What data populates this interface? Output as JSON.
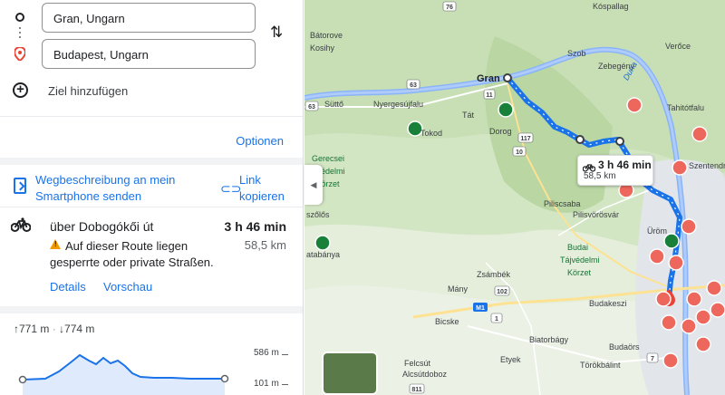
{
  "directions": {
    "origin": "Gran, Ungarn",
    "destination": "Budapest, Ungarn",
    "add_destination": "Ziel hinzufügen"
  },
  "options_label": "Optionen",
  "send_label": "Wegbeschreibung an mein Smartphone senden",
  "copy_link_label": "Link kopieren",
  "route": {
    "name": "über Dobogókői út",
    "time": "3 h 46 min",
    "distance": "58,5 km",
    "warning": "Auf dieser Route liegen gesperrte oder private Straßen.",
    "details_label": "Details",
    "preview_label": "Vorschau"
  },
  "elevation": {
    "ascent": "771 m",
    "descent": "774 m",
    "max_label": "586 m",
    "min_label": "101 m"
  },
  "map": {
    "route_color": "#1a73e8",
    "callout_time": "3 h 46 min",
    "callout_distance": "58,5 km",
    "places": [
      "Gran",
      "Bátorove",
      "Kosihy",
      "Szob",
      "Zebegény",
      "Verőce",
      "Kóspallag",
      "Tahitótfalu",
      "Süttő",
      "Nyergesújfalu",
      "Tát",
      "Tokod",
      "Dorog",
      "Gerecsei",
      "tájvédelmi",
      "körzet",
      "Piliscsaba",
      "Pilisvörösvár",
      "Üröm",
      "Szentendre",
      "Budai",
      "Tájvédelmi",
      "Körzet",
      "Zsámbék",
      "Mány",
      "Bicske",
      "Budakeszi",
      "Biatorbágy",
      "Budaörs",
      "Etyek",
      "Felcsút",
      "Alcsútdoboz",
      "Törökbálint",
      "Duna",
      "szőlős",
      "atabánya"
    ],
    "road_labels": [
      "76",
      "63",
      "11",
      "117",
      "10",
      "102",
      "M1",
      "1",
      "7",
      "811"
    ]
  }
}
